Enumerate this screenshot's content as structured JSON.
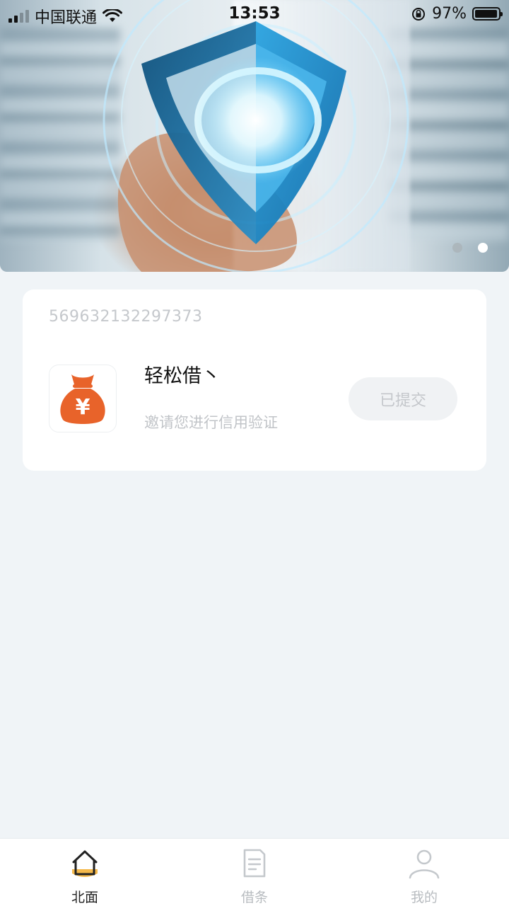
{
  "status_bar": {
    "carrier": "中国联通",
    "time": "13:53",
    "battery_percent": "97%",
    "battery_level": 0.97,
    "signal_bars": 2
  },
  "banner": {
    "active_slide_index": 1,
    "slide_count": 2
  },
  "loan_card": {
    "id_number": "569632132297373",
    "app_name": "轻松借丶",
    "app_desc": "邀请您进行信用验证",
    "app_icon": "money-bag-yuan-icon",
    "status_button_label": "已提交"
  },
  "tab_bar": {
    "tabs": [
      {
        "label": "北面",
        "icon": "home-icon",
        "active": true
      },
      {
        "label": "借条",
        "icon": "document-icon",
        "active": false
      },
      {
        "label": "我的",
        "icon": "user-icon",
        "active": false
      }
    ]
  },
  "colors": {
    "page_background": "#f0f4f7",
    "accent_orange": "#e8632a",
    "home_icon_yellow": "#f5b94a",
    "muted_text": "#c1c4c8"
  }
}
